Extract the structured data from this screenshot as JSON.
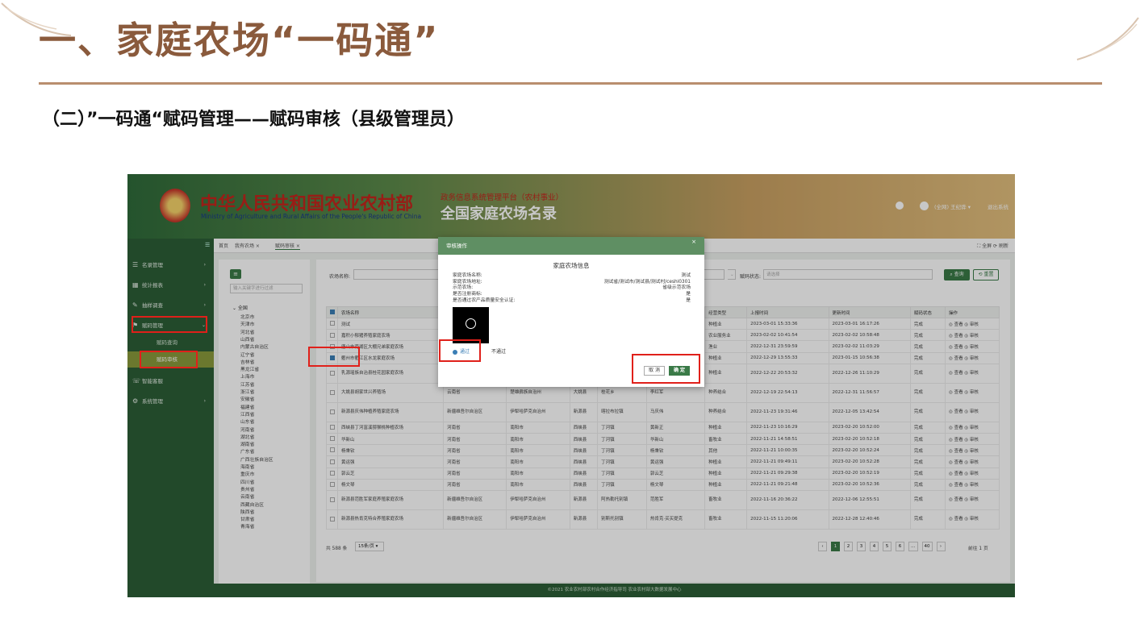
{
  "slide": {
    "title": "一、家庭农场“一码通”",
    "subtitle": "（二）”一码通“赋码管理——赋码审核（县级管理员）"
  },
  "header": {
    "ministry_cn": "中华人民共和国农业农村部",
    "ministry_en": "Ministry of Agriculture and Rural Affairs of the People's Republic of China",
    "platform_sub": "政务信息系统管理平台（农村事业）",
    "platform_main": "全国家庭农场名录",
    "user_name": "(全网) 王纪骅 ▾",
    "logout": "退出系统"
  },
  "sidebar": {
    "collapse": "☰",
    "items": [
      {
        "label": "名录管理",
        "icon": "☰"
      },
      {
        "label": "统计报表",
        "icon": "▦"
      },
      {
        "label": "抽样调查",
        "icon": "✎"
      },
      {
        "label": "赋码管理",
        "icon": "⚑"
      },
      {
        "label": "智能客服",
        "icon": "☏"
      },
      {
        "label": "系统管理",
        "icon": "⚙"
      }
    ],
    "subitems": [
      "赋码查询",
      "赋码审核"
    ]
  },
  "tabs": {
    "items": [
      "首页",
      "我有农场 ×",
      "赋码审核 ×"
    ],
    "right": "⛶ 全屏 ⟳ 刷新"
  },
  "tree": {
    "search_placeholder": "输入关键字进行过滤",
    "root": "⌄ 全国",
    "provinces": [
      "北京市",
      "天津市",
      "河北省",
      "山西省",
      "内蒙古自治区",
      "辽宁省",
      "吉林省",
      "黑龙江省",
      "上海市",
      "江苏省",
      "浙江省",
      "安徽省",
      "福建省",
      "江西省",
      "山东省",
      "河南省",
      "湖北省",
      "湖南省",
      "广东省",
      "广西壮族自治区",
      "海南省",
      "重庆市",
      "四川省",
      "贵州省",
      "云南省",
      "西藏自治区",
      "陕西省",
      "甘肃省",
      "青海省"
    ]
  },
  "filters": {
    "farm_name_label": "农场名称:",
    "status_label": "赋码状态:",
    "status_placeholder": "请选择",
    "query": "⌕ 查询",
    "reset": "⟲ 重置"
  },
  "table": {
    "headers": [
      "",
      "农场名称",
      "",
      "",
      "",
      "",
      "",
      "经营类型",
      "上报时间",
      "更新时间",
      "赋码状态",
      "操作"
    ],
    "rows": [
      {
        "checked": false,
        "name": "测试",
        "c2": "",
        "c3": "",
        "c4": "",
        "c5": "",
        "c6": "",
        "type": "种植业",
        "report": "2023-03-01 15:33:36",
        "update": "2023-03-01 16:17:26",
        "status": "完成",
        "ops": "◎ 查看 ◎ 审核",
        "tall": false
      },
      {
        "checked": false,
        "name": "嘉积小郁猪养殖家庭农场",
        "c2": "",
        "c3": "",
        "c4": "",
        "c5": "",
        "c6": "",
        "type": "农业服务业",
        "report": "2023-02-02 10:41:54",
        "update": "2023-02-02 10:58:48",
        "status": "完成",
        "ops": "◎ 查看 ◎ 审核",
        "tall": false
      },
      {
        "checked": false,
        "name": "唐山市南湖区大棚兄弟家庭农场",
        "c2": "",
        "c3": "",
        "c4": "",
        "c5": "",
        "c6": "",
        "type": "渔业",
        "report": "2022-12-31 23:59:59",
        "update": "2023-02-02 11:03:29",
        "status": "完成",
        "ops": "◎ 查看 ◎ 审核",
        "tall": false
      },
      {
        "checked": true,
        "name": "衢州市衢江区水龙家庭农场",
        "c2": "",
        "c3": "",
        "c4": "",
        "c5": "",
        "c6": "",
        "type": "种植业",
        "report": "2022-12-29 13:55:33",
        "update": "2023-01-15 10:56:38",
        "status": "完成",
        "ops": "◎ 查看 ◎ 审核",
        "tall": false
      },
      {
        "checked": false,
        "name": "乳源瑶族自治县桂花园家庭农场",
        "c2": "",
        "c3": "",
        "c4": "",
        "c5": "",
        "c6": "",
        "type": "种植业",
        "report": "2022-12-22 20:53:32",
        "update": "2022-12-26 11:10:29",
        "status": "完成",
        "ops": "◎ 查看 ◎ 审核",
        "tall": true
      },
      {
        "checked": false,
        "name": "大姚县胡家世兴养殖场",
        "c2": "云南省",
        "c3": "楚雄彝族自治州",
        "c4": "大姚县",
        "c5": "桂花乡",
        "c6": "李红军",
        "type": "种养结合",
        "report": "2022-12-19 22:54:13",
        "update": "2022-12-31 11:56:57",
        "status": "完成",
        "ops": "◎ 查看 ◎ 审核",
        "tall": true
      },
      {
        "checked": false,
        "name": "新源县庆伟种植养殖家庭农场",
        "c2": "新疆维吾尔自治区",
        "c3": "伊犁哈萨克自治州",
        "c4": "新源县",
        "c5": "喀拉布拉镇",
        "c6": "马庆伟",
        "type": "种养结合",
        "report": "2022-11-23 19:31:46",
        "update": "2022-12-05 13:42:54",
        "status": "完成",
        "ops": "◎ 查看 ◎ 审核",
        "tall": true
      },
      {
        "checked": false,
        "name": "西峡县丁河富溪猕猴桃种植农场",
        "c2": "河南省",
        "c3": "南阳市",
        "c4": "西峡县",
        "c5": "丁河镇",
        "c6": "黄新正",
        "type": "种植业",
        "report": "2022-11-23 10:16:29",
        "update": "2023-02-20 10:52:00",
        "status": "完成",
        "ops": "◎ 查看 ◎ 审核",
        "tall": false
      },
      {
        "checked": false,
        "name": "华新山",
        "c2": "河南省",
        "c3": "南阳市",
        "c4": "西峡县",
        "c5": "丁河镇",
        "c6": "华新山",
        "type": "畜牧业",
        "report": "2022-11-21 14:58:51",
        "update": "2023-02-20 10:52:18",
        "status": "完成",
        "ops": "◎ 查看 ◎ 审核",
        "tall": false
      },
      {
        "checked": false,
        "name": "杨秉钦",
        "c2": "河南省",
        "c3": "南阳市",
        "c4": "西峡县",
        "c5": "丁河镇",
        "c6": "杨秉钦",
        "type": "其他",
        "report": "2022-11-21 10:00:35",
        "update": "2023-02-20 10:52:24",
        "status": "完成",
        "ops": "◎ 查看 ◎ 审核",
        "tall": false
      },
      {
        "checked": false,
        "name": "黄运强",
        "c2": "河南省",
        "c3": "南阳市",
        "c4": "西峡县",
        "c5": "丁河镇",
        "c6": "黄运强",
        "type": "种植业",
        "report": "2022-11-21 09:49:11",
        "update": "2023-02-20 10:52:28",
        "status": "完成",
        "ops": "◎ 查看 ◎ 审核",
        "tall": false
      },
      {
        "checked": false,
        "name": "郭云芝",
        "c2": "河南省",
        "c3": "南阳市",
        "c4": "西峡县",
        "c5": "丁河镇",
        "c6": "郭云芝",
        "type": "种植业",
        "report": "2022-11-21 09:29:38",
        "update": "2023-02-20 10:52:19",
        "status": "完成",
        "ops": "◎ 查看 ◎ 审核",
        "tall": false
      },
      {
        "checked": false,
        "name": "杨文琴",
        "c2": "河南省",
        "c3": "南阳市",
        "c4": "西峡县",
        "c5": "丁河镇",
        "c6": "杨文琴",
        "type": "种植业",
        "report": "2022-11-21 09:21:48",
        "update": "2023-02-20 10:52:36",
        "status": "完成",
        "ops": "◎ 查看 ◎ 审核",
        "tall": false
      },
      {
        "checked": false,
        "name": "新源县范胜军家庭养殖家庭农场",
        "c2": "新疆维吾尔自治区",
        "c3": "伊犁哈萨克自治州",
        "c4": "新源县",
        "c5": "阿热勒托别镇",
        "c6": "范胜军",
        "type": "畜牧业",
        "report": "2022-11-16 20:36:22",
        "update": "2022-12-06 12:55:51",
        "status": "完成",
        "ops": "◎ 查看 ◎ 审核",
        "tall": true
      },
      {
        "checked": false,
        "name": "新源县热肯克特合养殖家庭农场",
        "c2": "新疆维吾尔自治区",
        "c3": "伊犁哈萨克自治州",
        "c4": "新源县",
        "c5": "别斯托别镇",
        "c6": "热肯克·买买提克",
        "type": "畜牧业",
        "report": "2022-11-15 11:20:06",
        "update": "2022-12-28 12:40:46",
        "status": "完成",
        "ops": "◎ 查看 ◎ 审核",
        "tall": true
      }
    ]
  },
  "pager": {
    "total": "共 588 条",
    "size": "15条/页 ▾",
    "pages": [
      "‹",
      "1",
      "2",
      "3",
      "4",
      "5",
      "6",
      "…",
      "40",
      "›"
    ],
    "goto": "前往  1  页"
  },
  "footer": "©2021 农业农村部农村合作经济指导司 农业农村部大数据发展中心",
  "dialog": {
    "head": "审核操作",
    "close": "×",
    "title": "家庭农场信息",
    "rows": [
      {
        "k": "家庭农场名称:",
        "v": "测试"
      },
      {
        "k": "家庭农场地址:",
        "v": "测试省/测试市/测试县/测试村/ceshi0301"
      },
      {
        "k": "示范农场:",
        "v": "省级示范农场"
      },
      {
        "k": "是否注册商标:",
        "v": "是"
      },
      {
        "k": "是否通过农产品质量安全认证:",
        "v": "是"
      }
    ],
    "pass": "通过",
    "fail": "不通过",
    "cancel": "取 消",
    "ok": "确 定"
  },
  "colors": {
    "accent_green": "#3a7a47",
    "title_brown": "#8a5a3c",
    "highlight_red": "#e0201a"
  }
}
